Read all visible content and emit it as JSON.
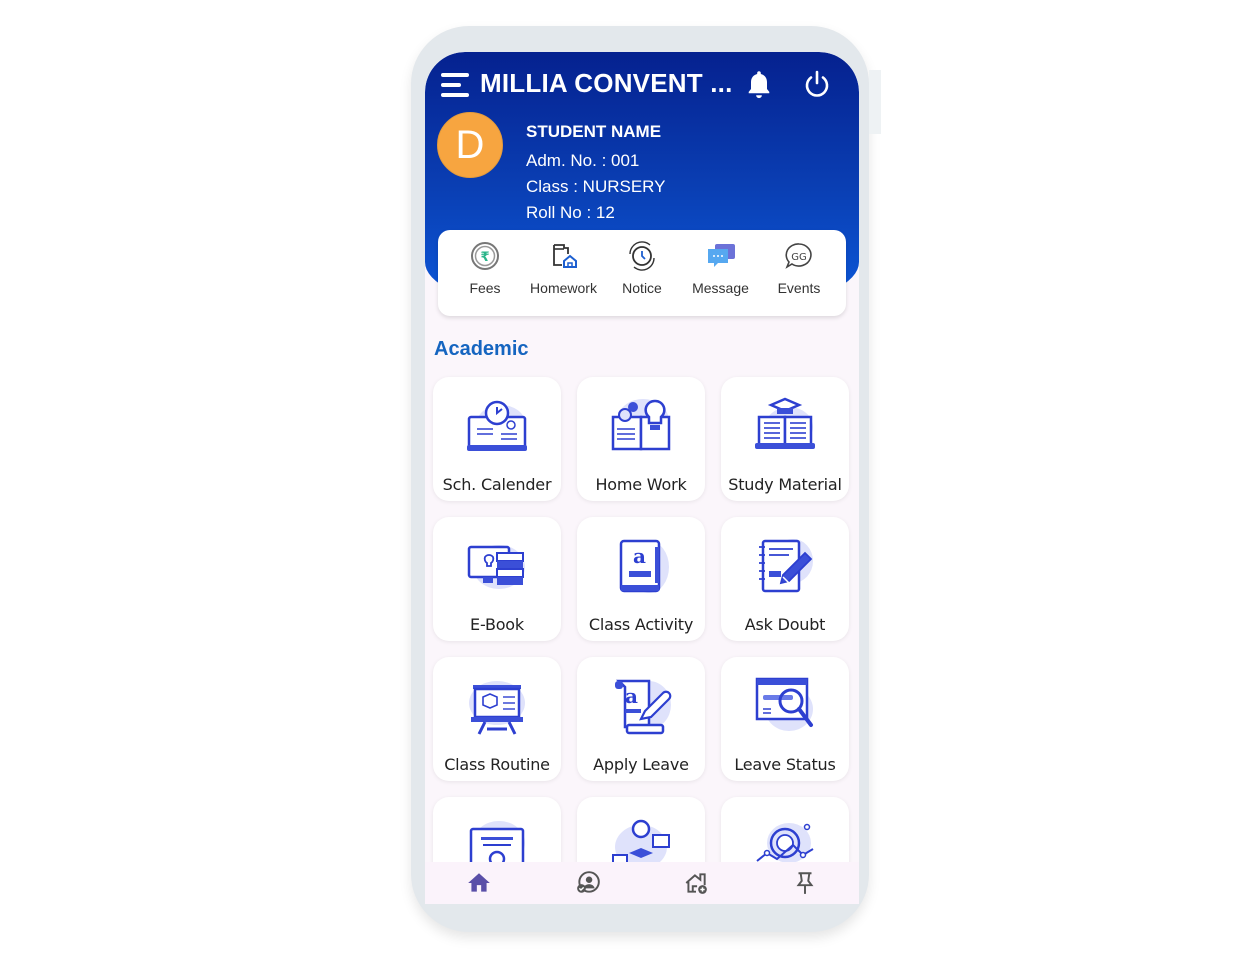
{
  "header": {
    "app_title": "MILLIA CONVENT ...",
    "menu_icon": "hamburger-menu-icon",
    "bell_icon": "notification-bell-icon",
    "power_icon": "power-logout-icon"
  },
  "student": {
    "avatar_initial": "D",
    "avatar_color": "#f7a540",
    "name": "STUDENT NAME",
    "adm_no": "Adm. No. :  001",
    "class": "Class : NURSERY",
    "roll_no": "Roll No : 12"
  },
  "quick_actions": [
    {
      "label": "Fees",
      "icon": "rupee-coin-icon"
    },
    {
      "label": "Homework",
      "icon": "folder-home-icon"
    },
    {
      "label": "Notice",
      "icon": "clock-refresh-icon"
    },
    {
      "label": "Message",
      "icon": "chat-bubbles-icon"
    },
    {
      "label": "Events",
      "icon": "speech-bubble-icon"
    }
  ],
  "section": {
    "title": "Academic"
  },
  "academic_items": [
    {
      "label": "Sch. Calender",
      "icon": "calendar-book-clock-icon"
    },
    {
      "label": "Home Work",
      "icon": "open-book-bulb-icon"
    },
    {
      "label": "Study Material",
      "icon": "book-graduation-cap-icon"
    },
    {
      "label": "E-Book",
      "icon": "monitor-books-icon"
    },
    {
      "label": "Class Activity",
      "icon": "alphabet-book-icon"
    },
    {
      "label": "Ask Doubt",
      "icon": "notebook-highlighter-icon"
    },
    {
      "label": "Class Routine",
      "icon": "presentation-board-icon"
    },
    {
      "label": "Apply Leave",
      "icon": "scroll-pen-icon"
    },
    {
      "label": "Leave Status",
      "icon": "magnifier-document-icon"
    },
    {
      "label": "",
      "icon": "certificate-icon"
    },
    {
      "label": "",
      "icon": "graduate-gear-icon"
    },
    {
      "label": "",
      "icon": "analytics-network-icon"
    }
  ],
  "bottom_nav": [
    {
      "icon": "home-icon",
      "active": true
    },
    {
      "icon": "user-check-icon",
      "active": false
    },
    {
      "icon": "house-add-icon",
      "active": false
    },
    {
      "icon": "pin-icon",
      "active": false
    }
  ],
  "colors": {
    "header_top": "#05218f",
    "header_bottom": "#0c57d8",
    "section_title": "#1565c0",
    "icon_accent": "#3b4fd8",
    "nav_active": "#5a4fa8"
  }
}
